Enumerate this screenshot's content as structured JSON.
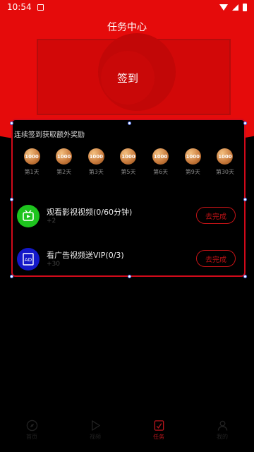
{
  "status_bar": {
    "time": "10:54"
  },
  "header": {
    "title": "任务中心",
    "signin_label": "签到"
  },
  "checkin": {
    "title": "连续签到获取额外奖励",
    "rewards": [
      {
        "amount": "1000",
        "day": "第1天"
      },
      {
        "amount": "1000",
        "day": "第2天"
      },
      {
        "amount": "1000",
        "day": "第3天"
      },
      {
        "amount": "1000",
        "day": "第5天"
      },
      {
        "amount": "1000",
        "day": "第6天"
      },
      {
        "amount": "1000",
        "day": "第9天"
      },
      {
        "amount": "1000",
        "day": "第30天"
      }
    ]
  },
  "tasks": [
    {
      "name": "观看影视视频(0/60分钟)",
      "reward": "+2",
      "button": "去完成",
      "icon": "tv-icon",
      "icon_color": "#1ec41e"
    },
    {
      "name": "看广告视频送VIP(0/3)",
      "reward": "+30",
      "button": "去完成",
      "icon": "ad-icon",
      "icon_color": "#1418c8"
    }
  ],
  "tabbar": {
    "active_color": "#b5161c",
    "items": [
      {
        "label": "首页",
        "icon": "compass-icon",
        "active": false
      },
      {
        "label": "视频",
        "icon": "play-icon",
        "active": false
      },
      {
        "label": "任务",
        "icon": "task-icon",
        "active": true
      },
      {
        "label": "我的",
        "icon": "user-icon",
        "active": false
      }
    ]
  }
}
